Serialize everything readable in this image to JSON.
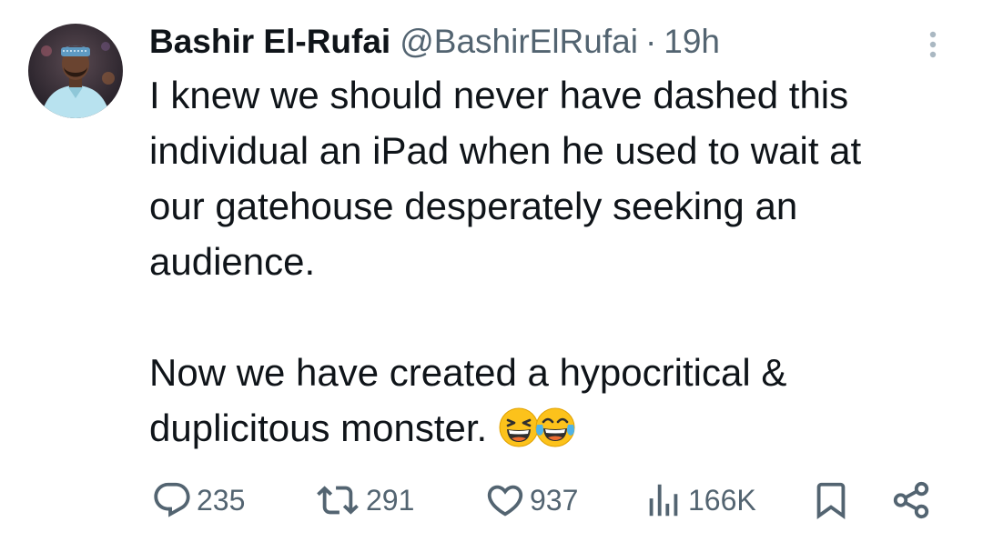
{
  "tweet": {
    "author_name": "Bashir El-Rufai",
    "author_handle": "@BashirElRufai",
    "separator": "·",
    "time": "19h",
    "lines_paragraph1": [
      "I knew we should never have dashed this",
      "individual an iPad when he used to wait at",
      "our gatehouse desperately seeking an",
      "audience."
    ],
    "lines_paragraph2": [
      "Now we have created a hypocritical &",
      "duplicitous monster."
    ],
    "emojis": [
      "grinning-squinting-face",
      "face-with-tears-of-joy"
    ]
  },
  "actions": {
    "replies": "235",
    "reposts": "291",
    "likes": "937",
    "views": "166K"
  },
  "icons": {
    "reply": "speech-bubble-icon",
    "repost": "repost-arrows-icon",
    "like": "heart-icon",
    "views": "bar-chart-icon",
    "bookmark": "bookmark-icon",
    "share": "share-icon",
    "more": "vertical-ellipsis-icon"
  },
  "colors": {
    "text": "#0f1419",
    "secondary": "#536471",
    "background": "#ffffff"
  }
}
